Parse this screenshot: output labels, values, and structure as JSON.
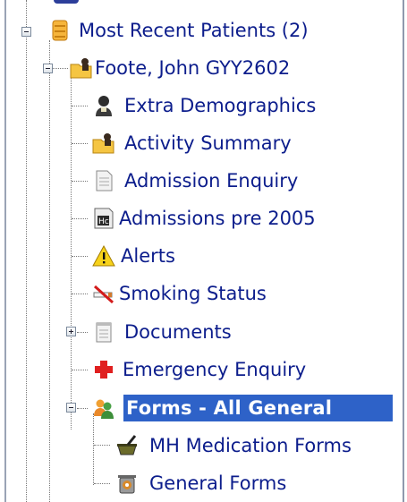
{
  "tree": {
    "root": {
      "label": "Most Recent Patients (2)",
      "icon": "folder-box-icon"
    },
    "patient": {
      "label": "Foote, John GYY2602",
      "icon": "patient-folder-icon"
    },
    "items": [
      {
        "label": "Extra Demographics",
        "icon": "person-silhouette-icon"
      },
      {
        "label": "Activity Summary",
        "icon": "patient-folder-icon"
      },
      {
        "label": "Admission Enquiry",
        "icon": "document-icon"
      },
      {
        "label": "Admissions pre 2005",
        "icon": "hc-document-icon"
      },
      {
        "label": "Alerts",
        "icon": "warning-icon"
      },
      {
        "label": "Smoking Status",
        "icon": "no-smoking-icon"
      },
      {
        "label": "Documents",
        "icon": "notepad-icon"
      },
      {
        "label": "Emergency Enquiry",
        "icon": "red-cross-icon"
      },
      {
        "label": "Forms - All General",
        "icon": "users-icon"
      }
    ],
    "subitems": [
      {
        "label": "MH Medication Forms",
        "icon": "mortar-pestle-icon"
      },
      {
        "label": "General Forms",
        "icon": "trash-bin-icon"
      }
    ]
  },
  "colors": {
    "link_text": "#0c1d8c",
    "selection": "#2e62c8"
  }
}
